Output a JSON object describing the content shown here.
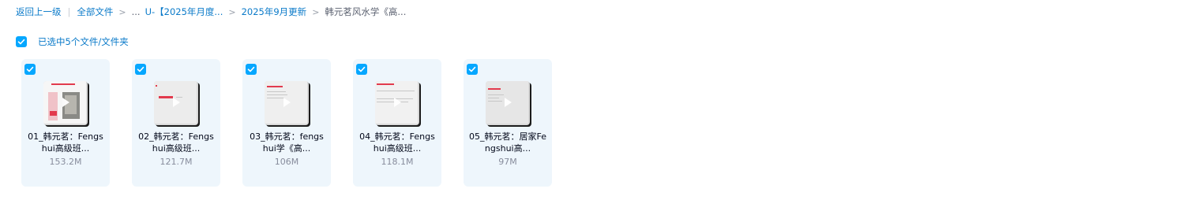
{
  "breadcrumb": {
    "back": "返回上一级",
    "root": "全部文件",
    "ellipsis": "...",
    "folder1": "U-【2025年月度...",
    "folder2": "2025年9月更新",
    "current": "韩元茗风水学《高..."
  },
  "selection": {
    "label": "已选中5个文件/文件夹"
  },
  "files": [
    {
      "name": "01_韩元茗：Fengshui高级班...",
      "size": "153.2M"
    },
    {
      "name": "02_韩元茗：Fengshui高级班...",
      "size": "121.7M"
    },
    {
      "name": "03_韩元茗：fengshui学《高...",
      "size": "106M"
    },
    {
      "name": "04_韩元茗：Fengshui高级班...",
      "size": "118.1M"
    },
    {
      "name": "05_韩元茗：居家Fengshui高...",
      "size": "97M"
    }
  ],
  "colors": {
    "accent": "#06a7ff",
    "link": "#0a7ac9",
    "card_bg": "#eef6fc"
  },
  "icons": [
    "checkbox-checked-icon",
    "chevron-right-icon",
    "play-icon"
  ]
}
